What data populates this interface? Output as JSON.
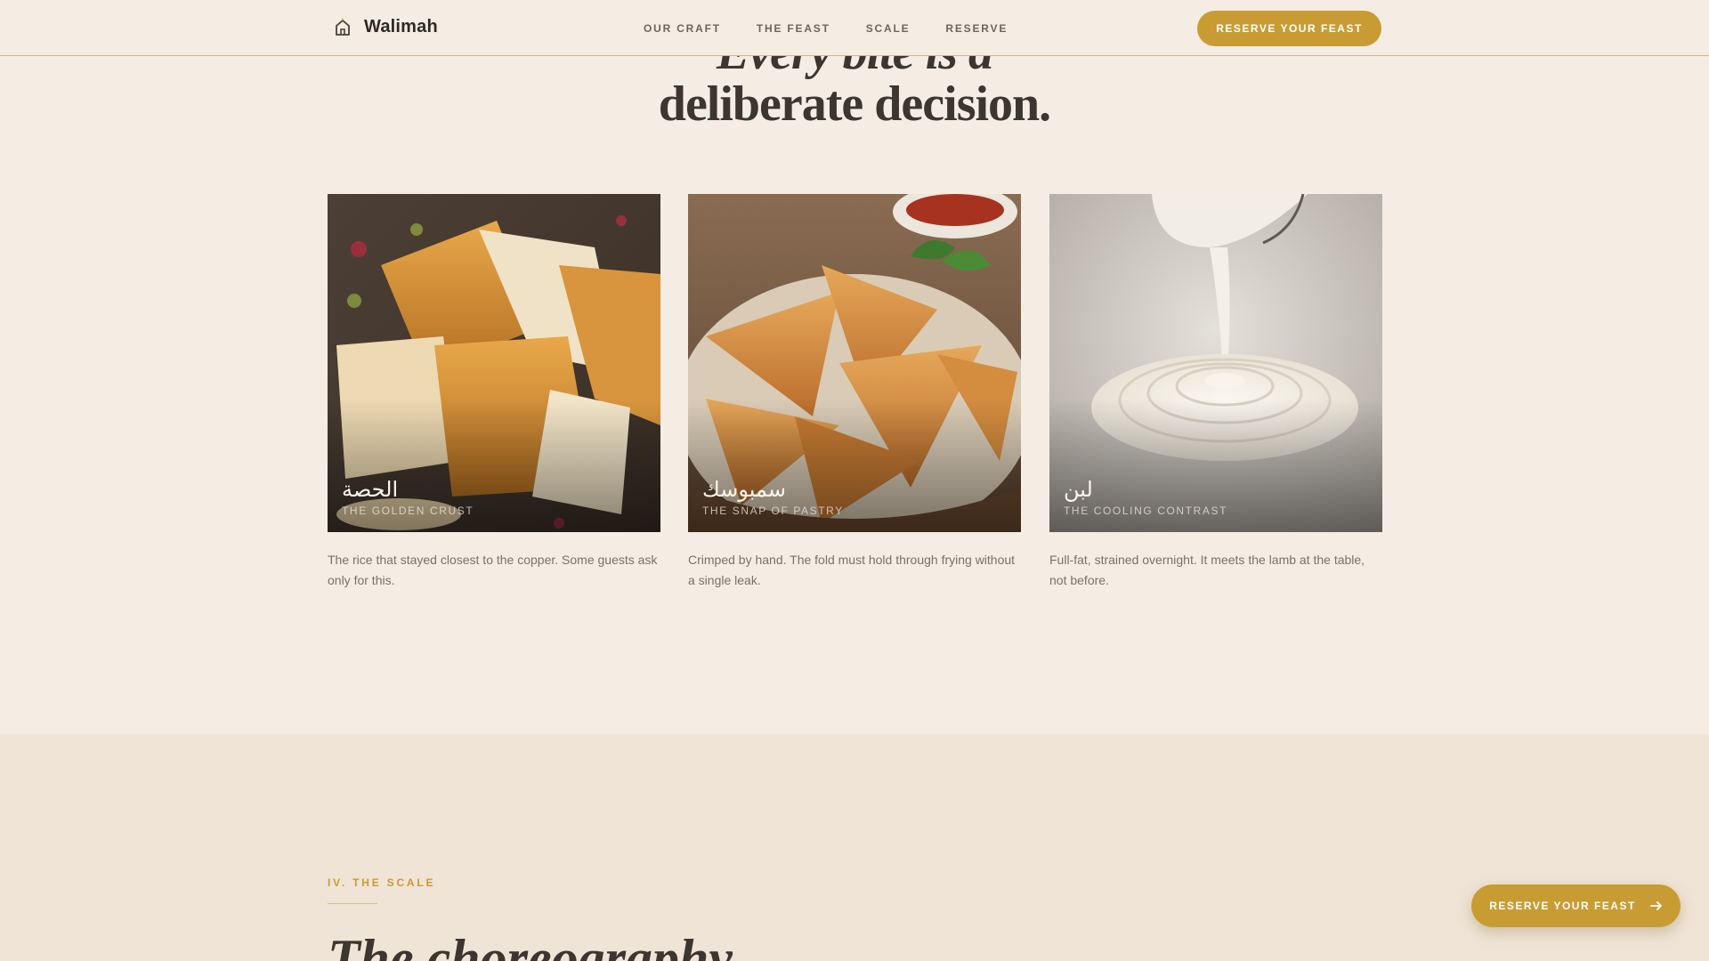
{
  "nav": {
    "brand": "Walimah",
    "brand_icon": "house-icon",
    "links": [
      "OUR CRAFT",
      "THE FEAST",
      "SCALE",
      "RESERVE"
    ],
    "cta": "RESERVE YOUR FEAST"
  },
  "hero": {
    "line1": "Every bite is a",
    "line2": "deliberate decision."
  },
  "dishes": [
    {
      "arabic": "الحصة",
      "subtitle": "THE GOLDEN CRUST",
      "description": "The rice that stayed closest to the copper. Some guests ask only for this."
    },
    {
      "arabic": "سمبوسك",
      "subtitle": "THE SNAP OF PASTRY",
      "description": "Crimped by hand. The fold must hold through frying without a single leak."
    },
    {
      "arabic": "لبن",
      "subtitle": "THE COOLING CONTRAST",
      "description": "Full-fat, strained overnight. It meets the lamb at the table, not before."
    }
  ],
  "scale": {
    "kicker": "IV. THE SCALE",
    "heading": "The choreography"
  },
  "floating_cta": {
    "label": "RESERVE YOUR FEAST",
    "icon": "arrow-right-icon"
  },
  "colors": {
    "accent": "#c99c33",
    "background": "#f5ede4",
    "section_background": "#efe4d6",
    "text_dark": "#3d3530"
  }
}
